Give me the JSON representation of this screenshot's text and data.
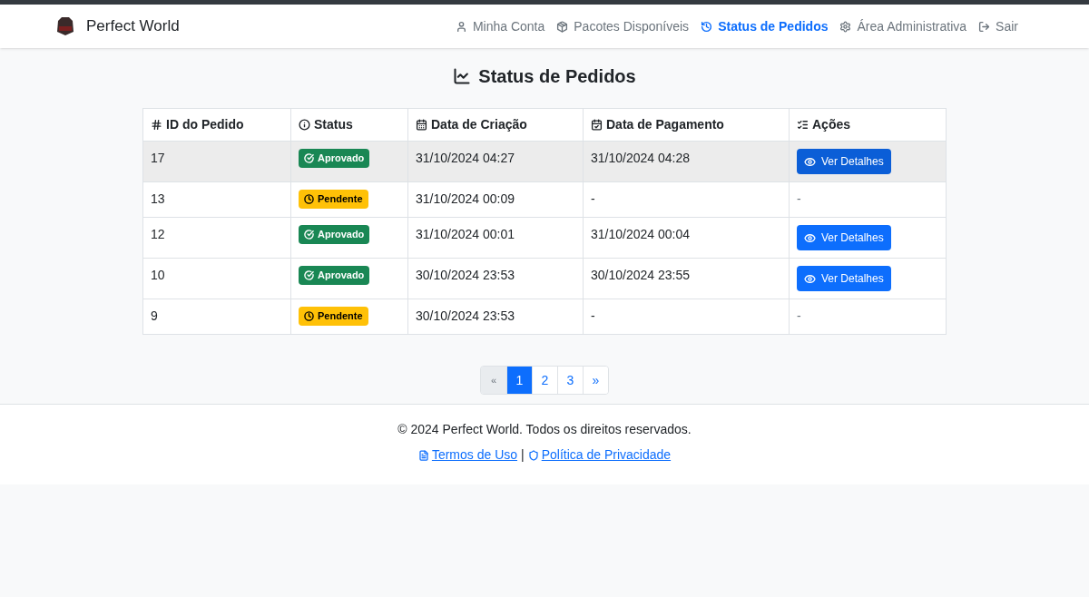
{
  "navbar": {
    "brand": "Perfect World",
    "items": [
      {
        "label": "Minha Conta",
        "selected": false
      },
      {
        "label": "Pacotes Disponíveis",
        "selected": false
      },
      {
        "label": "Status de Pedidos",
        "selected": true
      },
      {
        "label": "Área Administrativa",
        "selected": false
      },
      {
        "label": "Sair",
        "selected": false
      }
    ]
  },
  "page_title": "Status de Pedidos",
  "table": {
    "columns": [
      "ID do Pedido",
      "Status",
      "Data de Criação",
      "Data de Pagamento",
      "Ações"
    ],
    "rows": [
      {
        "id": "17",
        "status": {
          "kind": "approved",
          "label": "Aprovado"
        },
        "created": "31/10/2024 04:27",
        "paid": "31/10/2024 04:28",
        "action": {
          "kind": "button",
          "label": "Ver Detalhes"
        },
        "selected": true
      },
      {
        "id": "13",
        "status": {
          "kind": "pending",
          "label": "Pendente"
        },
        "created": "31/10/2024 00:09",
        "paid": "-",
        "action": {
          "kind": "text",
          "label": "-"
        },
        "selected": false
      },
      {
        "id": "12",
        "status": {
          "kind": "approved",
          "label": "Aprovado"
        },
        "created": "31/10/2024 00:01",
        "paid": "31/10/2024 00:04",
        "action": {
          "kind": "button",
          "label": "Ver Detalhes"
        },
        "selected": false
      },
      {
        "id": "10",
        "status": {
          "kind": "approved",
          "label": "Aprovado"
        },
        "created": "30/10/2024 23:53",
        "paid": "30/10/2024 23:55",
        "action": {
          "kind": "button",
          "label": "Ver Detalhes"
        },
        "selected": false
      },
      {
        "id": "9",
        "status": {
          "kind": "pending",
          "label": "Pendente"
        },
        "created": "30/10/2024 23:53",
        "paid": "-",
        "action": {
          "kind": "text",
          "label": "-"
        },
        "selected": false
      }
    ]
  },
  "pagination": [
    {
      "label": "«",
      "selected": false,
      "disabled": true
    },
    {
      "label": "1",
      "selected": true,
      "disabled": false
    },
    {
      "label": "2",
      "selected": false,
      "disabled": false
    },
    {
      "label": "3",
      "selected": false,
      "disabled": false
    },
    {
      "label": "»",
      "selected": false,
      "disabled": false
    }
  ],
  "footer": {
    "copyright": "© 2024 Perfect World. Todos os direitos reservados.",
    "links": [
      "Termos de Uso",
      "Política de Privacidade"
    ],
    "separator": "|"
  }
}
